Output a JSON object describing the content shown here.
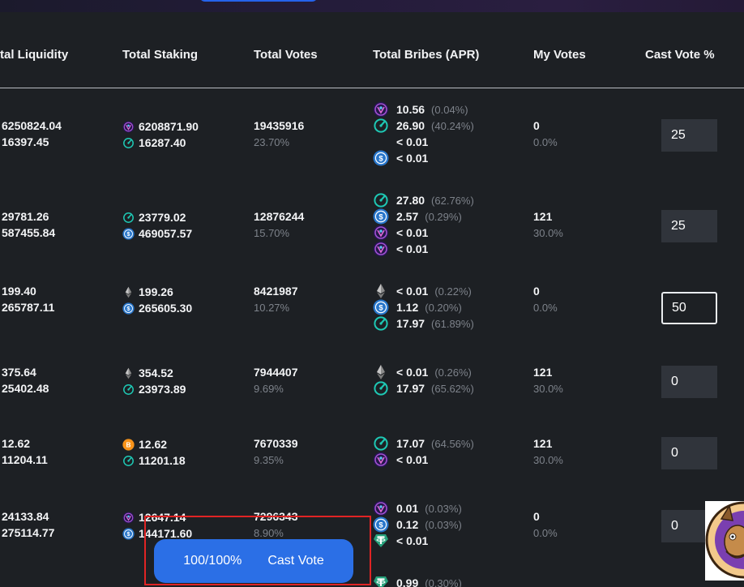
{
  "columns": {
    "liquidity": "tal Liquidity",
    "staking": "Total Staking",
    "votes": "Total Votes",
    "bribes": "Total Bribes (APR)",
    "my_votes": "My Votes",
    "cast_vote": "Cast Vote %"
  },
  "rows": [
    {
      "liquidity": [
        "6250824.04",
        "16397.45"
      ],
      "staking": [
        {
          "icon": "purple-token-icon",
          "value": "6208871.90"
        },
        {
          "icon": "teal-gauge-token-icon",
          "value": "16287.40"
        }
      ],
      "votes": "19435916",
      "votes_pct": "23.70%",
      "bribes": [
        {
          "icon": "purple-token-icon",
          "value": "10.56",
          "apr": "(0.04%)"
        },
        {
          "icon": "teal-gauge-token-icon",
          "value": "26.90",
          "apr": "(40.24%)"
        },
        {
          "icon": "",
          "value": "< 0.01",
          "apr": ""
        },
        {
          "icon": "usdc-token-icon",
          "value": "< 0.01",
          "apr": ""
        }
      ],
      "my_votes": "0",
      "my_votes_pct": "0.0%",
      "cast_vote": "25"
    },
    {
      "liquidity": [
        "29781.26",
        "587455.84"
      ],
      "staking": [
        {
          "icon": "teal-gauge-token-icon",
          "value": "23779.02"
        },
        {
          "icon": "usdc-token-icon",
          "value": "469057.57"
        }
      ],
      "votes": "12876244",
      "votes_pct": "15.70%",
      "bribes": [
        {
          "icon": "teal-gauge-token-icon",
          "value": "27.80",
          "apr": "(62.76%)"
        },
        {
          "icon": "usdc-token-icon",
          "value": "2.57",
          "apr": "(0.29%)"
        },
        {
          "icon": "purple-token-icon",
          "value": "< 0.01",
          "apr": ""
        },
        {
          "icon": "purple-token-icon",
          "value": "< 0.01",
          "apr": ""
        }
      ],
      "my_votes": "121",
      "my_votes_pct": "30.0%",
      "cast_vote": "25"
    },
    {
      "liquidity": [
        "199.40",
        "265787.11"
      ],
      "staking": [
        {
          "icon": "ethereum-icon",
          "value": "199.26"
        },
        {
          "icon": "usdc-token-icon",
          "value": "265605.30"
        }
      ],
      "votes": "8421987",
      "votes_pct": "10.27%",
      "bribes": [
        {
          "icon": "ethereum-icon",
          "value": "< 0.01",
          "apr": "(0.22%)"
        },
        {
          "icon": "usdc-token-icon",
          "value": "1.12",
          "apr": "(0.20%)"
        },
        {
          "icon": "teal-gauge-token-icon",
          "value": "17.97",
          "apr": "(61.89%)"
        }
      ],
      "my_votes": "0",
      "my_votes_pct": "0.0%",
      "cast_vote": "50"
    },
    {
      "liquidity": [
        "375.64",
        "25402.48"
      ],
      "staking": [
        {
          "icon": "ethereum-icon",
          "value": "354.52"
        },
        {
          "icon": "teal-gauge-token-icon",
          "value": "23973.89"
        }
      ],
      "votes": "7944407",
      "votes_pct": "9.69%",
      "bribes": [
        {
          "icon": "ethereum-icon",
          "value": "< 0.01",
          "apr": "(0.26%)"
        },
        {
          "icon": "teal-gauge-token-icon",
          "value": "17.97",
          "apr": "(65.62%)"
        }
      ],
      "my_votes": "121",
      "my_votes_pct": "30.0%",
      "cast_vote": "0"
    },
    {
      "liquidity": [
        "12.62",
        "11204.11"
      ],
      "staking": [
        {
          "icon": "bitcoin-icon",
          "value": "12.62"
        },
        {
          "icon": "teal-gauge-token-icon",
          "value": "11201.18"
        }
      ],
      "votes": "7670339",
      "votes_pct": "9.35%",
      "bribes": [
        {
          "icon": "teal-gauge-token-icon",
          "value": "17.07",
          "apr": "(64.56%)"
        },
        {
          "icon": "purple-token-icon",
          "value": "< 0.01",
          "apr": ""
        }
      ],
      "my_votes": "121",
      "my_votes_pct": "30.0%",
      "cast_vote": "0"
    },
    {
      "liquidity": [
        "24133.84",
        "275114.77"
      ],
      "staking": [
        {
          "icon": "purple-token-icon",
          "value": "12647.14"
        },
        {
          "icon": "usdc-token-icon",
          "value": "144171.60"
        }
      ],
      "votes": "7296343",
      "votes_pct": "8.90%",
      "bribes": [
        {
          "icon": "purple-token-icon",
          "value": "0.01",
          "apr": "(0.03%)"
        },
        {
          "icon": "usdc-token-icon",
          "value": "0.12",
          "apr": "(0.03%)"
        },
        {
          "icon": "tether-icon",
          "value": "< 0.01",
          "apr": ""
        },
        {
          "icon": "",
          "value": "",
          "apr": ""
        },
        {
          "icon": "tether-icon",
          "value": "0.99",
          "apr": "(0.30%)"
        }
      ],
      "my_votes": "0",
      "my_votes_pct": "0.0%",
      "cast_vote": "0"
    }
  ],
  "cast_button": {
    "progress": "100/100%",
    "label": "Cast Vote"
  },
  "colors": {
    "background": "#1d2024",
    "accent": "#2b6fe6",
    "highlight_box": "#e02424",
    "muted": "#7d828a"
  }
}
